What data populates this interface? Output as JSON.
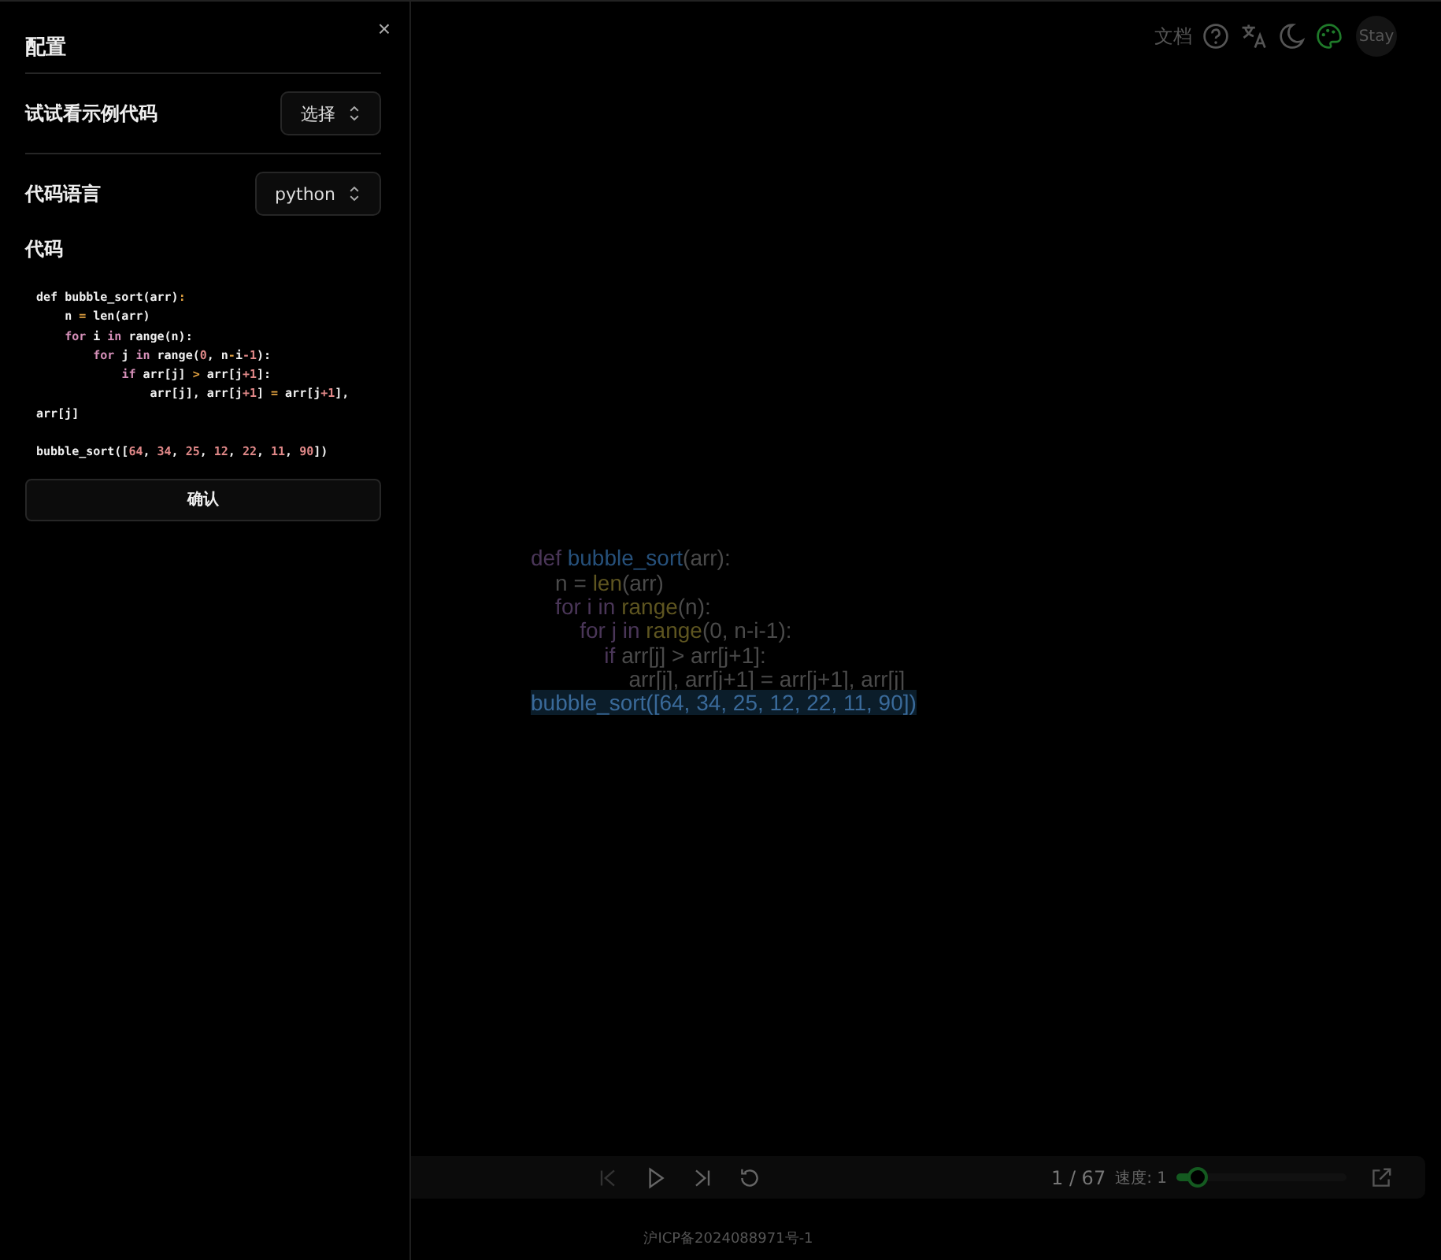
{
  "toolbar": {
    "docs_link": "文档",
    "avatar": "Stay"
  },
  "canvas_code": [
    [
      {
        "t": "def ",
        "kind": "kw"
      },
      {
        "t": "bubble_sort",
        "kind": "fn"
      },
      {
        "t": "(arr):",
        "kind": "p"
      }
    ],
    [
      {
        "t": "    n = ",
        "kind": "p"
      },
      {
        "t": "len",
        "kind": "bi"
      },
      {
        "t": "(arr)",
        "kind": "p"
      }
    ],
    [
      {
        "t": "    for i in ",
        "kind": "kw"
      },
      {
        "t": "range",
        "kind": "bi"
      },
      {
        "t": "(n):",
        "kind": "p"
      }
    ],
    [
      {
        "t": "        for j in ",
        "kind": "kw"
      },
      {
        "t": "range",
        "kind": "bi"
      },
      {
        "t": "(0, n-i-1):",
        "kind": "p"
      }
    ],
    [
      {
        "t": "            if ",
        "kind": "kw"
      },
      {
        "t": "arr[j] > arr[j+1]:",
        "kind": "p"
      }
    ],
    [
      {
        "t": "                arr[j], arr[j+1] = arr[j+1], arr[j]",
        "kind": "p"
      }
    ],
    [
      {
        "t": "bubble_sort([64, 34, 25, 12, 22, 11, 90])",
        "kind": "hl"
      }
    ]
  ],
  "player": {
    "progress": "1 / 67",
    "speed": "速度: 1",
    "level": 0.12
  },
  "footer": "沪ICP备2024088971号-1",
  "panel": {
    "title": "配置",
    "close": "×",
    "example_label": "试试看示例代码",
    "example_select": "选择",
    "language_label": "代码语言",
    "language_select": "python",
    "code_label": "代码",
    "code": [
      {
        "gap_before": false,
        "tokens": [
          {
            "t": "def ",
            "kind": "p"
          },
          {
            "t": "bubble_sort(arr)",
            "kind": "p"
          },
          {
            "t": ":",
            "kind": "op"
          }
        ]
      },
      {
        "gap_before": false,
        "tokens": [
          {
            "t": "    n ",
            "kind": "p"
          },
          {
            "t": "=",
            "kind": "op"
          },
          {
            "t": " len(arr)",
            "kind": "p"
          }
        ]
      },
      {
        "gap_before": false,
        "tokens": [
          {
            "t": "    for ",
            "kind": "kw"
          },
          {
            "t": "i ",
            "kind": "p"
          },
          {
            "t": "in ",
            "kind": "kw"
          },
          {
            "t": "range(n):",
            "kind": "p"
          }
        ]
      },
      {
        "gap_before": false,
        "tokens": [
          {
            "t": "        for ",
            "kind": "kw"
          },
          {
            "t": "j ",
            "kind": "p"
          },
          {
            "t": "in ",
            "kind": "kw"
          },
          {
            "t": "range(",
            "kind": "p"
          },
          {
            "t": "0",
            "kind": "num"
          },
          {
            "t": ", n",
            "kind": "p"
          },
          {
            "t": "-",
            "kind": "op"
          },
          {
            "t": "i",
            "kind": "p"
          },
          {
            "t": "-1",
            "kind": "num"
          },
          {
            "t": "):",
            "kind": "p"
          }
        ]
      },
      {
        "gap_before": false,
        "tokens": [
          {
            "t": "            if ",
            "kind": "kw"
          },
          {
            "t": "arr[j] ",
            "kind": "p"
          },
          {
            "t": ">",
            "kind": "op"
          },
          {
            "t": " arr[j",
            "kind": "p"
          },
          {
            "t": "+1",
            "kind": "num"
          },
          {
            "t": "]:",
            "kind": "p"
          }
        ]
      },
      {
        "gap_before": false,
        "tokens": [
          {
            "t": "                arr[j], arr[j",
            "kind": "p"
          },
          {
            "t": "+1",
            "kind": "num"
          },
          {
            "t": "] ",
            "kind": "p"
          },
          {
            "t": "=",
            "kind": "op"
          },
          {
            "t": " arr[j",
            "kind": "p"
          },
          {
            "t": "+1",
            "kind": "num"
          },
          {
            "t": "], arr[j]",
            "kind": "p"
          }
        ]
      },
      {
        "gap_before": true,
        "tokens": [
          {
            "t": "bubble_sort([",
            "kind": "p"
          },
          {
            "t": "64",
            "kind": "num"
          },
          {
            "t": ", ",
            "kind": "p"
          },
          {
            "t": "34",
            "kind": "num"
          },
          {
            "t": ", ",
            "kind": "p"
          },
          {
            "t": "25",
            "kind": "num"
          },
          {
            "t": ", ",
            "kind": "p"
          },
          {
            "t": "12",
            "kind": "num"
          },
          {
            "t": ", ",
            "kind": "p"
          },
          {
            "t": "22",
            "kind": "num"
          },
          {
            "t": ", ",
            "kind": "p"
          },
          {
            "t": "11",
            "kind": "num"
          },
          {
            "t": ", ",
            "kind": "p"
          },
          {
            "t": "90",
            "kind": "num"
          },
          {
            "t": "])",
            "kind": "p"
          }
        ]
      }
    ],
    "confirm": "确认"
  }
}
